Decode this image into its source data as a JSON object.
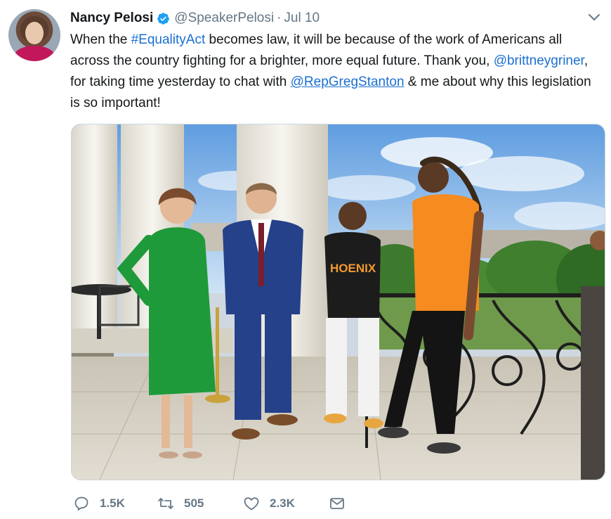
{
  "author": {
    "name": "Nancy Pelosi",
    "handle": "@SpeakerPelosi",
    "separator": "·",
    "date": "Jul 10"
  },
  "tweet": {
    "t1": "When the ",
    "hashtag": "#EqualityAct",
    "t2": " becomes law, it will be because of the work of Americans all across the country fighting for a brighter, more equal future. Thank you, ",
    "mention1": "@brittneygriner",
    "t3": ", for taking time yesterday to chat with ",
    "mention2": "@RepGregStanton",
    "t4": " & me about why this legislation is so important!",
    "jersey_text": "HOENIX"
  },
  "actions": {
    "replies": "1.5K",
    "retweets": "505",
    "likes": "2.3K"
  },
  "colors": {
    "link": "#1b6fd1",
    "verified": "#1da1f2",
    "muted": "#657786"
  }
}
